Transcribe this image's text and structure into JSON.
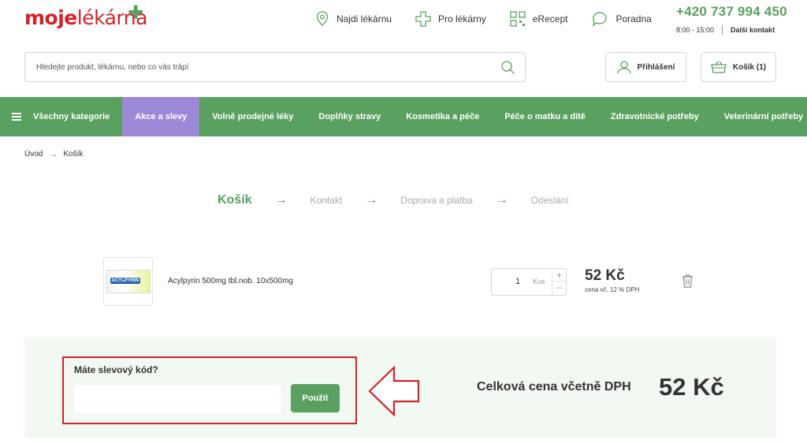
{
  "header": {
    "logo_part1": "moje",
    "logo_part2": "lékárna",
    "nav": [
      {
        "label": "Najdi lékárnu",
        "icon": "location-pin-icon"
      },
      {
        "label": "Pro lékárny",
        "icon": "pharmacy-cross-icon"
      },
      {
        "label": "eRecept",
        "icon": "qr-code-icon"
      },
      {
        "label": "Poradna",
        "icon": "chat-bubble-icon"
      }
    ],
    "phone": "+420 737 994 450",
    "hours": "8:00 - 15:00",
    "more_contact": "Další kontakt"
  },
  "search": {
    "placeholder": "Hledejte produkt, lékárnu, nebo co vás trápí"
  },
  "account": {
    "login_label": "Přihlášení",
    "cart_label": "Košík (1)"
  },
  "categories": {
    "all": "Všechny kategorie",
    "items": [
      "Akce a slevy",
      "Volně prodejné léky",
      "Doplňky stravy",
      "Kosmetika a péče",
      "Péče o matku a dítě",
      "Zdravotnické potřeby",
      "Veterinární potřeby"
    ]
  },
  "breadcrumb": {
    "home": "Úvod",
    "current": "Košík"
  },
  "steps": [
    "Košík",
    "Kontakt",
    "Doprava a platba",
    "Odeslání"
  ],
  "cart_item": {
    "name": "Acylpyrin 500mg tbl.nob. 10x500mg",
    "brand": "ACYLPYRIN",
    "quantity": "1",
    "unit": "Kus",
    "price": "52 Kč",
    "price_note": "cena vč. 12 % DPH"
  },
  "discount": {
    "label": "Máte slevový kód?",
    "input_value": "",
    "apply_label": "Použít"
  },
  "total": {
    "label": "Celková cena včetně DPH",
    "value": "52 Kč"
  },
  "colors": {
    "brand_green": "#5aa061",
    "brand_red": "#d2232a",
    "promo_purple": "#9d88d8"
  }
}
